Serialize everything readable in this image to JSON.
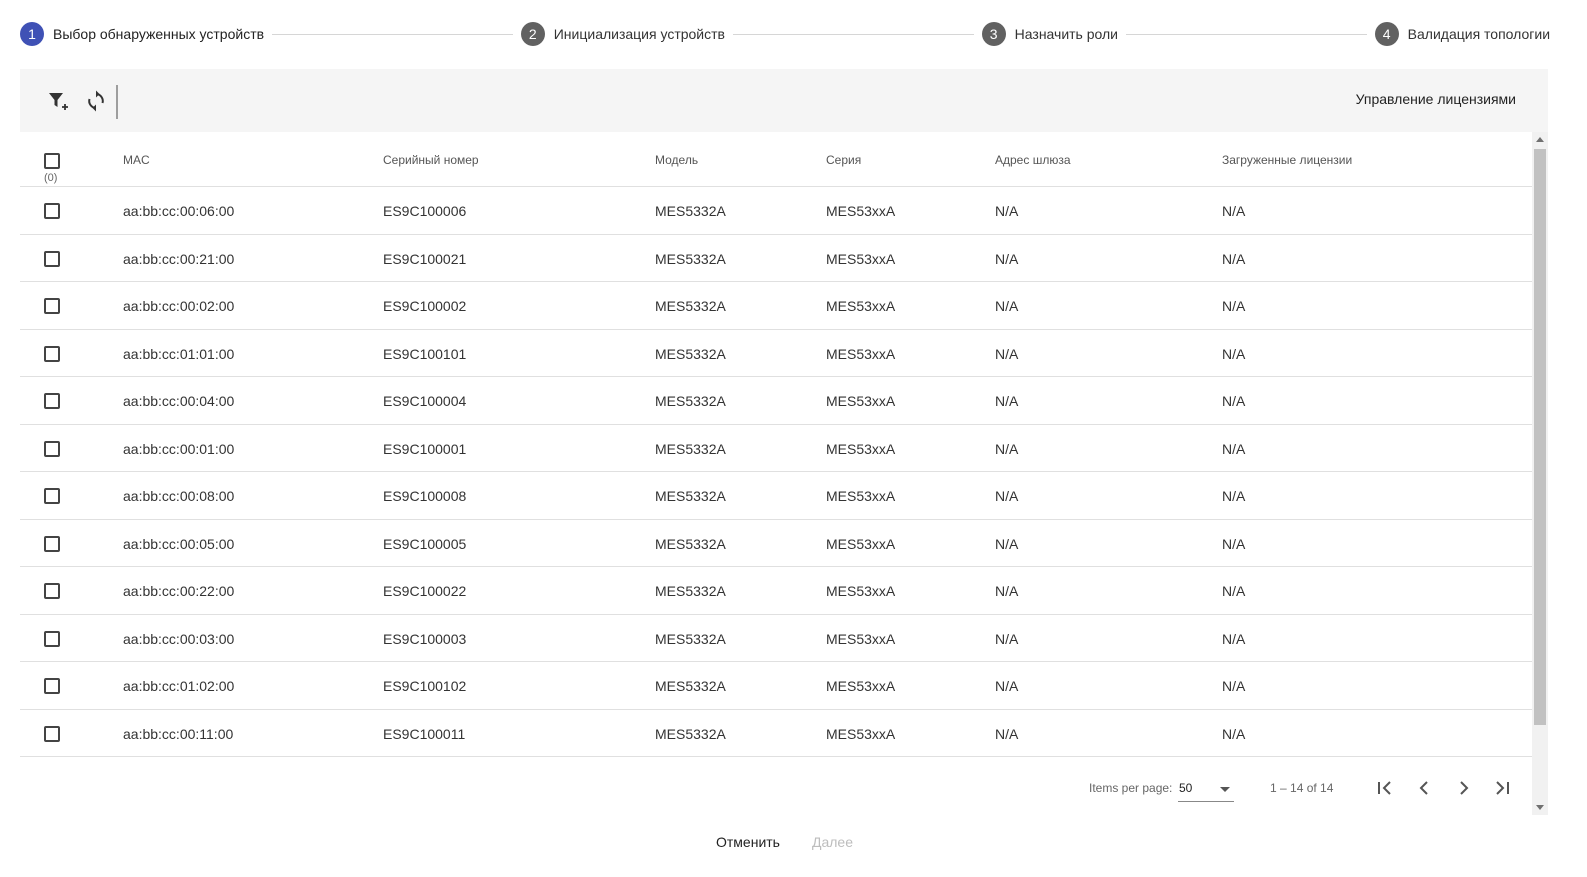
{
  "stepper": {
    "steps": [
      {
        "number": "1",
        "label": "Выбор обнаруженных устройств"
      },
      {
        "number": "2",
        "label": "Инициализация устройств"
      },
      {
        "number": "3",
        "label": "Назначить роли"
      },
      {
        "number": "4",
        "label": "Валидация топологии"
      }
    ]
  },
  "toolbar": {
    "license_label": "Управление лицензиями",
    "icons": [
      "filter-add-icon",
      "refresh-icon"
    ]
  },
  "table": {
    "selected_count": "(0)",
    "columns": [
      "MAC",
      "Серийный номер",
      "Модель",
      "Серия",
      "Адрес шлюза",
      "Загруженные лицензии"
    ],
    "rows": [
      [
        "aa:bb:cc:00:06:00",
        "ES9C100006",
        "MES5332A",
        "MES53xxA",
        "N/A",
        "N/A"
      ],
      [
        "aa:bb:cc:00:21:00",
        "ES9C100021",
        "MES5332A",
        "MES53xxA",
        "N/A",
        "N/A"
      ],
      [
        "aa:bb:cc:00:02:00",
        "ES9C100002",
        "MES5332A",
        "MES53xxA",
        "N/A",
        "N/A"
      ],
      [
        "aa:bb:cc:01:01:00",
        "ES9C100101",
        "MES5332A",
        "MES53xxA",
        "N/A",
        "N/A"
      ],
      [
        "aa:bb:cc:00:04:00",
        "ES9C100004",
        "MES5332A",
        "MES53xxA",
        "N/A",
        "N/A"
      ],
      [
        "aa:bb:cc:00:01:00",
        "ES9C100001",
        "MES5332A",
        "MES53xxA",
        "N/A",
        "N/A"
      ],
      [
        "aa:bb:cc:00:08:00",
        "ES9C100008",
        "MES5332A",
        "MES53xxA",
        "N/A",
        "N/A"
      ],
      [
        "aa:bb:cc:00:05:00",
        "ES9C100005",
        "MES5332A",
        "MES53xxA",
        "N/A",
        "N/A"
      ],
      [
        "aa:bb:cc:00:22:00",
        "ES9C100022",
        "MES5332A",
        "MES53xxA",
        "N/A",
        "N/A"
      ],
      [
        "aa:bb:cc:00:03:00",
        "ES9C100003",
        "MES5332A",
        "MES53xxA",
        "N/A",
        "N/A"
      ],
      [
        "aa:bb:cc:01:02:00",
        "ES9C100102",
        "MES5332A",
        "MES53xxA",
        "N/A",
        "N/A"
      ],
      [
        "aa:bb:cc:00:11:00",
        "ES9C100011",
        "MES5332A",
        "MES53xxA",
        "N/A",
        "N/A"
      ]
    ]
  },
  "paginator": {
    "items_per_page_label": "Items per page:",
    "items_per_page_value": "50",
    "range_label": "1 – 14 of 14"
  },
  "footer": {
    "cancel_label": "Отменить",
    "next_label": "Далее"
  },
  "colors": {
    "active_step": "#3f51b5",
    "inactive_step": "#616161",
    "toolbar_bg": "#f5f5f5",
    "disabled_text": "#bdbdbd"
  }
}
